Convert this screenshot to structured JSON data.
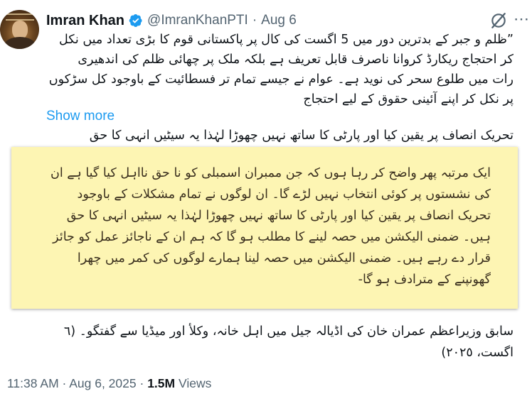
{
  "tweet": {
    "author_name": "Imran Khan",
    "handle": "@ImranKhanPTI",
    "separator": "·",
    "date": "Aug 6",
    "body_lines": [
      "”ظلم و جبر کے بدترین دور میں 5 اگست کی کال پر پاکستانی قوم کا بڑی تعداد میں نکل",
      "کر احتجاج ریکارڈ کروانا ناصرف قابل تعریف ہے  بلکہ ملک پر چھائی ظلم کی اندھیری",
      "رات میں طلوع سحر کی نوید ہے۔ عوام نے جیسے تمام تر فسطائیت کے باوجود کل سڑکوں",
      "پر نکل کر اپنے آئینی حقوق کے لیے احتجاج"
    ],
    "show_more": "Show more",
    "peek_line": "تحریک انصاف پر یقین کیا اور پارٹی کا ساتھ نہیں چھوڑا لہٰذا یہ سیٹیں انہی کا حق",
    "card_lines": [
      "ایک مرتبہ پھر واضح کر رہا ہوں کہ جن ممبران اسمبلی کو نا حق نااہل کیا گیا ہے ان",
      "کی نشستوں پر کوئی انتخاب نہیں لڑے گا۔ ان لوگوں نے تمام مشکلات کے باوجود",
      "تحریک انصاف پر یقین کیا اور پارٹی کا ساتھ نہیں چھوڑا لہٰذا یہ سیٹیں انہی کا حق",
      "ہیں۔ ضمنی الیکشن میں حصہ لینے کا مطلب ہو گا کہ ہم ان کے ناجائز عمل کو جائز",
      "قرار دے رہے ہیں۔ ضمنی الیکشن میں حصہ لینا ہمارے لوگوں کی کمر میں چھرا",
      "گھونپنے کے مترادف ہو گا-"
    ],
    "caption_lines": [
      "سابق وزیراعظم عمران خان کی اڈیالہ جیل میں اہل خانہ، وکلأ اور میڈیا سے گفتگو۔ (٦",
      "اگست، ٢٠٢٥)"
    ],
    "timestamp": "11:38 AM · Aug 6, 2025 ·",
    "views_count": "1.5M",
    "views_label": "Views"
  },
  "colors": {
    "link": "#1d9bf0",
    "verified": "#1d9bf0",
    "secondary_text": "#536471",
    "card_background": "#fdf5b3"
  },
  "icons": {
    "verified": "verified-badge-icon",
    "grok": "grok-icon",
    "more": "more-options-icon"
  }
}
